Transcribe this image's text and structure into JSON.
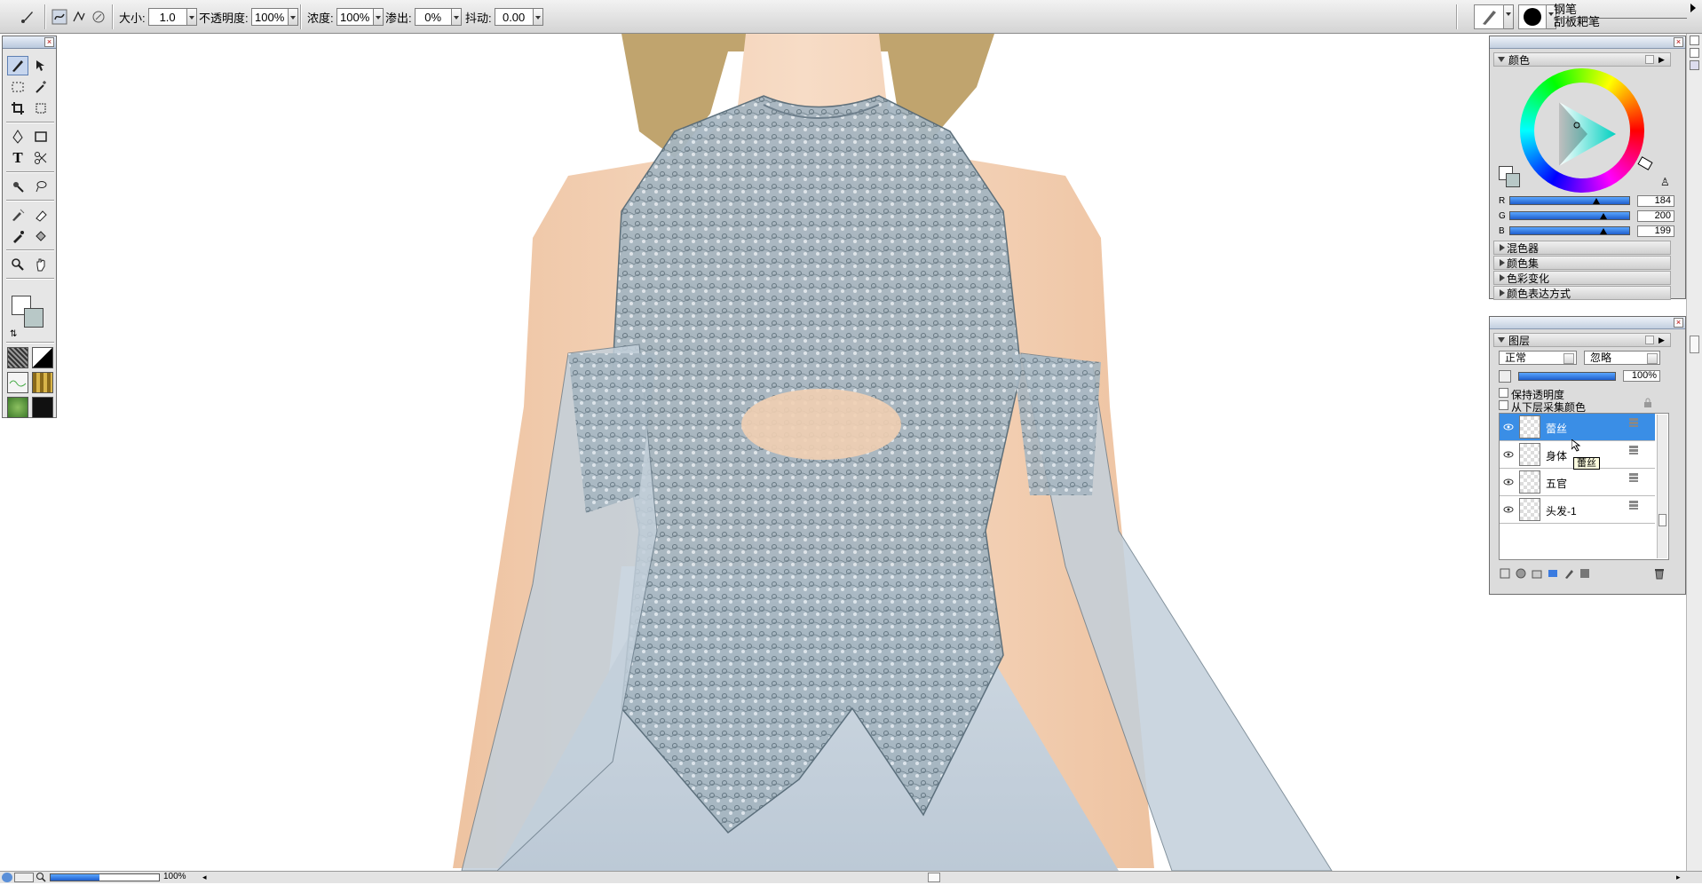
{
  "property_bar": {
    "tool_icon": "brush-icon",
    "size_label": "大小:",
    "size_value": "1.0",
    "opacity_label": "不透明度:",
    "opacity_value": "100%",
    "density_label": "浓度:",
    "density_value": "100%",
    "bleed_label": "渗出:",
    "bleed_value": "0%",
    "jitter_label": "抖动:",
    "jitter_value": "0.00",
    "brush_category": "钢笔",
    "brush_variant": "刮板耙笔"
  },
  "toolbox": {
    "tools": [
      "brush-tool",
      "layer-adjuster-tool",
      "rectangular-selection-tool",
      "magic-wand-tool",
      "crop-tool",
      "transform-tool",
      "pen-tool",
      "rectangle-shape-tool",
      "text-tool",
      "scissors-tool",
      "magnifier-rotate-tool",
      "lasso-tool",
      "blender-tool",
      "eraser-tool",
      "dropper-tool",
      "paint-bucket-tool",
      "magnifier-tool",
      "grabber-hand-tool"
    ],
    "colors": {
      "main": "#ffffff",
      "additional": "#b8c8c7"
    }
  },
  "color_palette": {
    "title": "颜色",
    "r_label": "R",
    "r_value": "184",
    "g_label": "G",
    "g_value": "200",
    "b_label": "B",
    "b_value": "199",
    "r_level": 0.72,
    "g_level": 0.78,
    "b_level": 0.78,
    "current_color": "#b8c8c7",
    "sections": [
      "混色器",
      "颜色集",
      "色彩变化",
      "颜色表达方式"
    ]
  },
  "layers_palette": {
    "title": "图层",
    "blend_mode": "正常",
    "composite": "忽略",
    "opacity": "100%",
    "preserve_transparency": "保持透明度",
    "pick_up_underlying": "从下层采集颜色",
    "layers": [
      {
        "name": "蕾丝",
        "selected": true
      },
      {
        "name": "身体",
        "selected": false
      },
      {
        "name": "五官",
        "selected": false
      },
      {
        "name": "头发-1",
        "selected": false
      }
    ],
    "tooltip": "蕾丝"
  },
  "status": {
    "zoom": "100%",
    "zoom_level": 0.45
  },
  "artwork": {
    "skin": "#f3d4b8",
    "lace": "#8a9ea8",
    "fabric": "#c9d4de",
    "hair": "#b99a5e"
  }
}
